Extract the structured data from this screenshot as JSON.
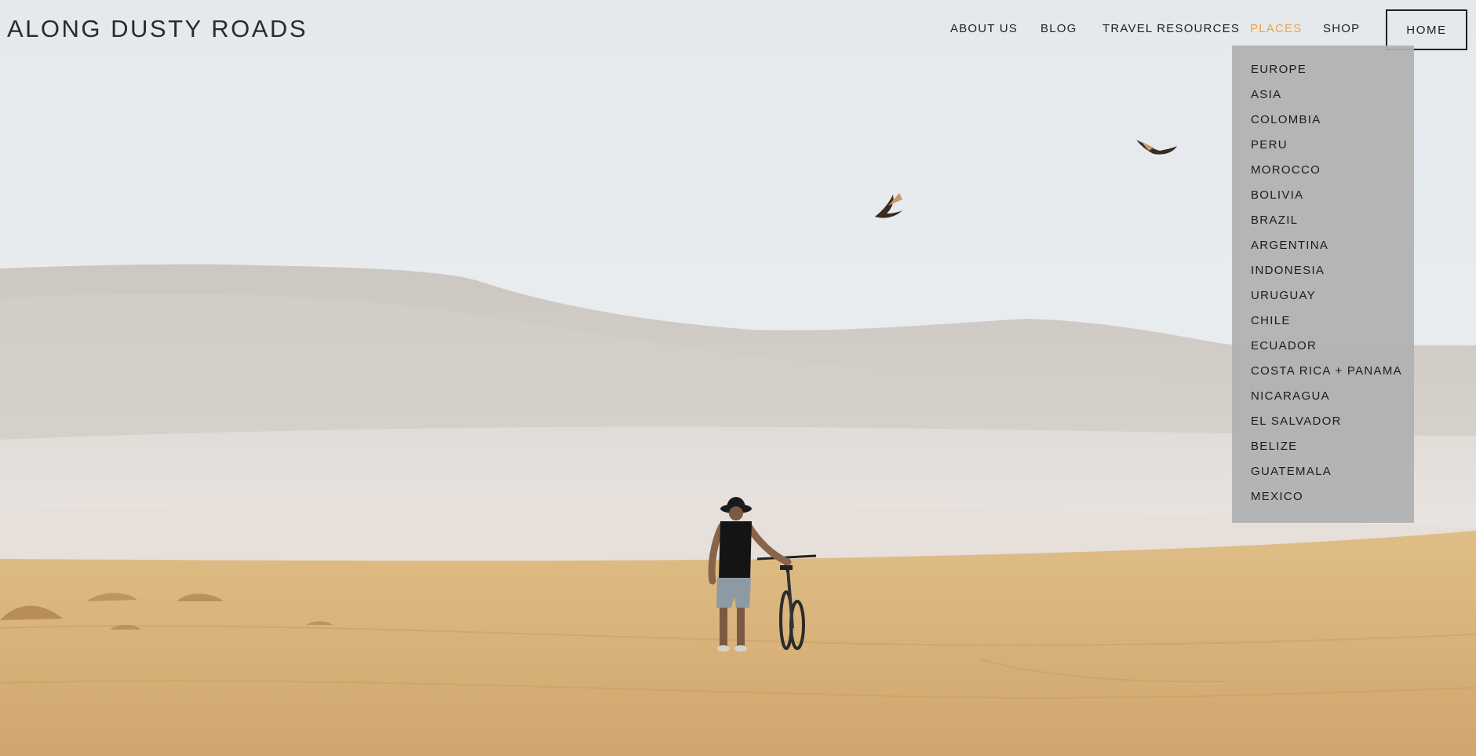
{
  "site": {
    "title": "ALONG DUSTY ROADS"
  },
  "nav": {
    "items": [
      "ABOUT US",
      "BLOG",
      "TRAVEL RESOURCES",
      "PLACES",
      "SHOP"
    ],
    "active_item": "PLACES",
    "home_label": "HOME"
  },
  "dropdown": {
    "items": [
      "EUROPE",
      "ASIA",
      "COLOMBIA",
      "PERU",
      "MOROCCO",
      "BOLIVIA",
      "BRAZIL",
      "ARGENTINA",
      "INDONESIA",
      "URUGUAY",
      "CHILE",
      "ECUADOR",
      "COSTA RICA + PANAMA",
      "NICARAGUA",
      "EL SALVADOR",
      "BELIZE",
      "GUATEMALA",
      "MEXICO"
    ]
  },
  "colors": {
    "active_nav": "#f2a33a",
    "text": "#1f1f1f",
    "dropdown_bg": "#b0b0b2",
    "sky": "#e9edf0",
    "sand": "#d9b57f"
  },
  "hero": {
    "scene": "desert-traveler-with-bicycle"
  }
}
